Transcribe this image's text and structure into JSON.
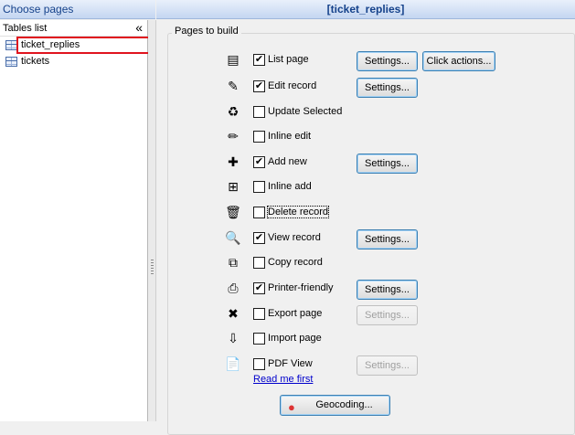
{
  "header": {
    "left_title": "Choose pages",
    "right_title": "[ticket_replies]"
  },
  "sidebar": {
    "label": "Tables list",
    "collapse_glyph": "«",
    "items": [
      {
        "label": "ticket_replies",
        "icon": "table-icon",
        "selected": true
      },
      {
        "label": "tickets",
        "icon": "table-icon",
        "selected": false
      }
    ]
  },
  "group": {
    "title": "Pages to build",
    "rows": [
      {
        "icon": "list-page-icon",
        "glyph": "▤",
        "label": "List page",
        "checked": true,
        "settings": "Settings...",
        "settings_enabled": true,
        "extra": "Click actions..."
      },
      {
        "icon": "edit-record-icon",
        "glyph": "✎",
        "label": "Edit record",
        "checked": true,
        "settings": "Settings...",
        "settings_enabled": true
      },
      {
        "icon": "update-selected-icon",
        "glyph": "♻",
        "label": "Update Selected",
        "checked": false
      },
      {
        "icon": "inline-edit-icon",
        "glyph": "✏",
        "label": "Inline edit",
        "checked": false
      },
      {
        "icon": "add-new-icon",
        "glyph": "✚",
        "label": "Add new",
        "checked": true,
        "settings": "Settings...",
        "settings_enabled": true
      },
      {
        "icon": "inline-add-icon",
        "glyph": "⊞",
        "label": "Inline add",
        "checked": false
      },
      {
        "icon": "delete-record-icon",
        "glyph": "🗑",
        "label": "Delete record",
        "checked": false,
        "focused": true
      },
      {
        "icon": "view-record-icon",
        "glyph": "🔍",
        "label": "View record",
        "checked": true,
        "settings": "Settings...",
        "settings_enabled": true
      },
      {
        "icon": "copy-record-icon",
        "glyph": "⧉",
        "label": "Copy record",
        "checked": false
      },
      {
        "icon": "printer-icon",
        "glyph": "⎙",
        "label": "Printer-friendly",
        "checked": true,
        "settings": "Settings...",
        "settings_enabled": true
      },
      {
        "icon": "excel-export-icon",
        "glyph": "✖",
        "label": "Export page",
        "checked": false,
        "settings": "Settings...",
        "settings_enabled": false
      },
      {
        "icon": "import-page-icon",
        "glyph": "⇩",
        "label": "Import page",
        "checked": false
      },
      {
        "icon": "pdf-icon",
        "glyph": "📄",
        "label": "PDF View",
        "checked": false,
        "settings": "Settings...",
        "settings_enabled": false
      }
    ],
    "read_me": "Read me first",
    "geocoding": "Geocoding..."
  }
}
